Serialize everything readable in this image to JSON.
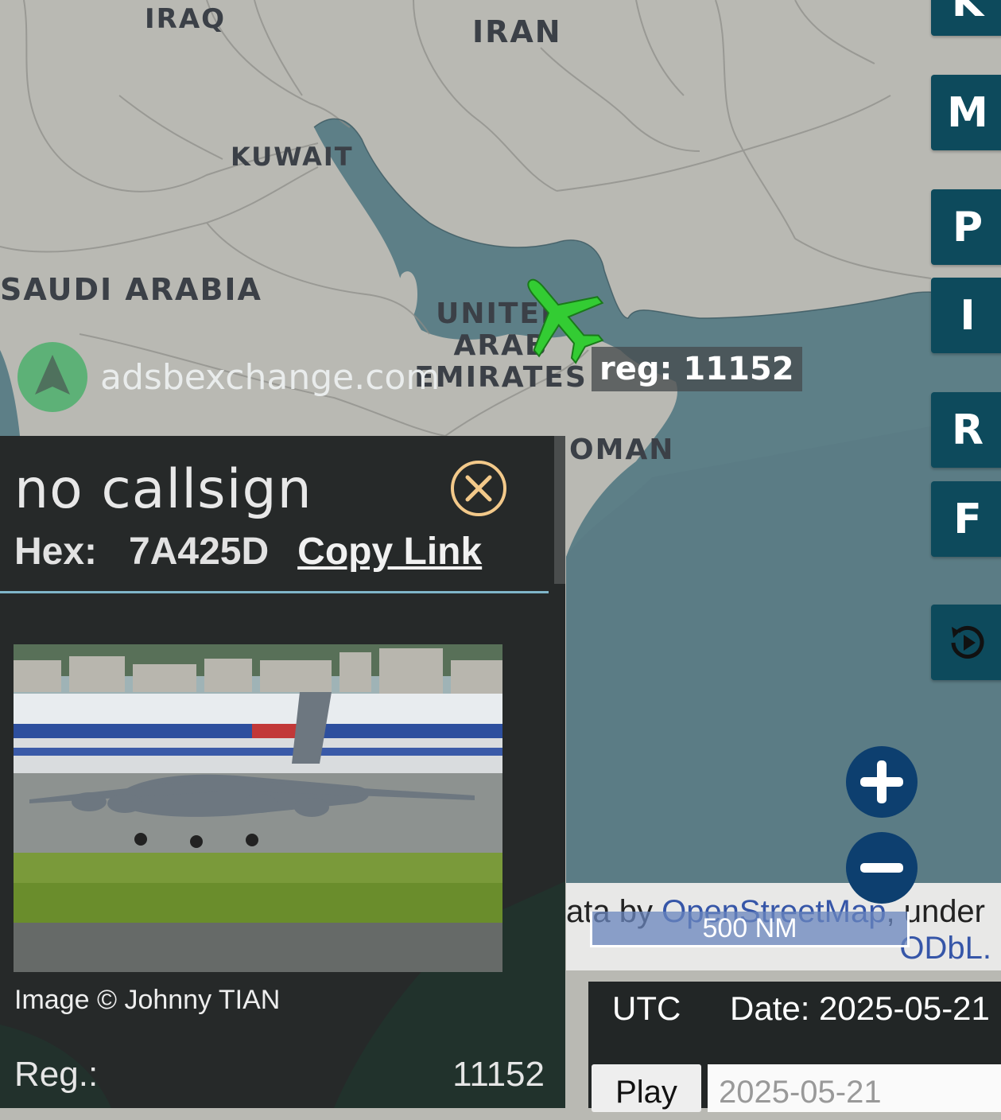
{
  "map": {
    "countries": [
      "IRAQ",
      "IRAN",
      "KUWAIT",
      "SAUDI ARABIA",
      "UNITED ARAB EMIRATES",
      "OMAN"
    ],
    "brand": "adsbexchange.com",
    "aircraft_label": "reg: 11152",
    "attribution": {
      "prefix": "ata by ",
      "link": "OpenStreetMap",
      "suffix": ", under",
      "license": "ODbL."
    },
    "scale": "500 NM",
    "colors": {
      "land": "#b9b9b3",
      "water": "#5d7f87",
      "aircraft": "#33cc33",
      "button": "#0d4a5c",
      "zoom_button": "#0d3f6f"
    }
  },
  "sidebar_buttons": {
    "k": "K",
    "m": "M",
    "p": "P",
    "i": "I",
    "r": "R",
    "f": "F",
    "replay_icon": "replay-icon"
  },
  "zoom": {
    "in_icon": "plus-icon",
    "out_icon": "minus-icon"
  },
  "time_panel": {
    "utc": "UTC",
    "date_label": "Date: 2025-05-21",
    "play_label": "Play",
    "date_value": "2025-05-21"
  },
  "info_panel": {
    "callsign": "no callsign",
    "hex_label": "Hex:",
    "hex_value": "7A425D",
    "copy_link": "Copy Link",
    "close_icon": "close-icon",
    "image_credit": "Image © Johnny TIAN",
    "reg_label": "Reg.:",
    "reg_value": "11152"
  }
}
